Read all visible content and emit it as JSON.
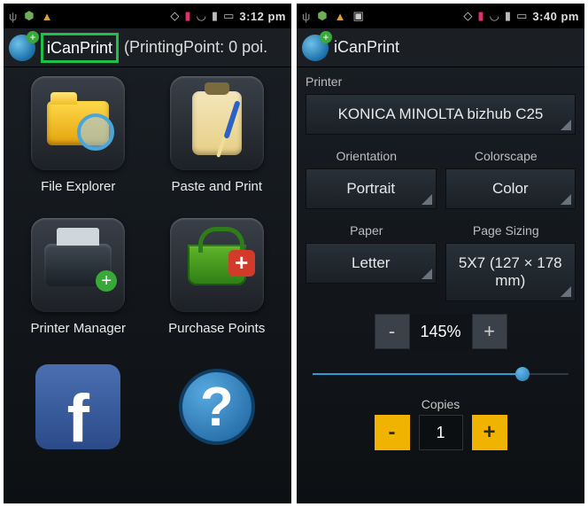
{
  "left": {
    "statusbar": {
      "time": "3:12 pm"
    },
    "appbar": {
      "title": "iCanPrint",
      "extra": "(PrintingPoint: 0 poi."
    },
    "tiles": [
      {
        "label": "File Explorer"
      },
      {
        "label": "Paste and Print"
      },
      {
        "label": "Printer Manager"
      },
      {
        "label": "Purchase Points"
      },
      {
        "label": ""
      },
      {
        "label": ""
      }
    ]
  },
  "right": {
    "statusbar": {
      "time": "3:40 pm"
    },
    "appbar": {
      "title": "iCanPrint"
    },
    "printer": {
      "label": "Printer",
      "value": "KONICA MINOLTA bizhub C25"
    },
    "orientation": {
      "label": "Orientation",
      "value": "Portrait"
    },
    "colorscape": {
      "label": "Colorscape",
      "value": "Color"
    },
    "paper": {
      "label": "Paper",
      "value": "Letter"
    },
    "page_sizing": {
      "label": "Page Sizing",
      "value": "5X7 (127 × 178 mm)"
    },
    "zoom": {
      "minus": "-",
      "value": "145%",
      "plus": "+",
      "slider_percent": 82
    },
    "copies": {
      "label": "Copies",
      "minus": "-",
      "value": "1",
      "plus": "+"
    }
  }
}
